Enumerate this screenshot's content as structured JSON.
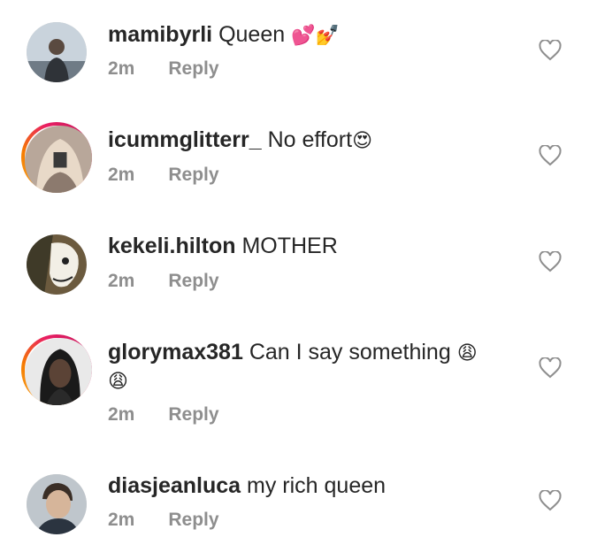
{
  "comments": [
    {
      "username": "mamibyrli",
      "text": "Queen",
      "emoji": "💕💅",
      "time": "2m",
      "reply_label": "Reply",
      "icon": "heart-outline-icon"
    },
    {
      "username": "icummglitterr_",
      "text": "No effort",
      "emoji": "😍",
      "time": "2m",
      "reply_label": "Reply",
      "icon": "heart-outline-icon"
    },
    {
      "username": "kekeli.hilton",
      "text": "MOTHER",
      "emoji": "",
      "time": "2m",
      "reply_label": "Reply",
      "icon": "heart-outline-icon"
    },
    {
      "username": "glorymax381",
      "text": "Can I say something",
      "emoji": "😩",
      "emoji_line2": "😩",
      "time": "2m",
      "reply_label": "Reply",
      "icon": "heart-outline-icon"
    },
    {
      "username": "diasjeanluca",
      "text": "my rich queen",
      "emoji": "",
      "time": "2m",
      "reply_label": "Reply",
      "icon": "heart-outline-icon"
    }
  ],
  "colors": {
    "text": "#262626",
    "meta": "#8e8e8e",
    "story_ring_start": "#f9a825",
    "story_ring_end": "#c2185b"
  }
}
